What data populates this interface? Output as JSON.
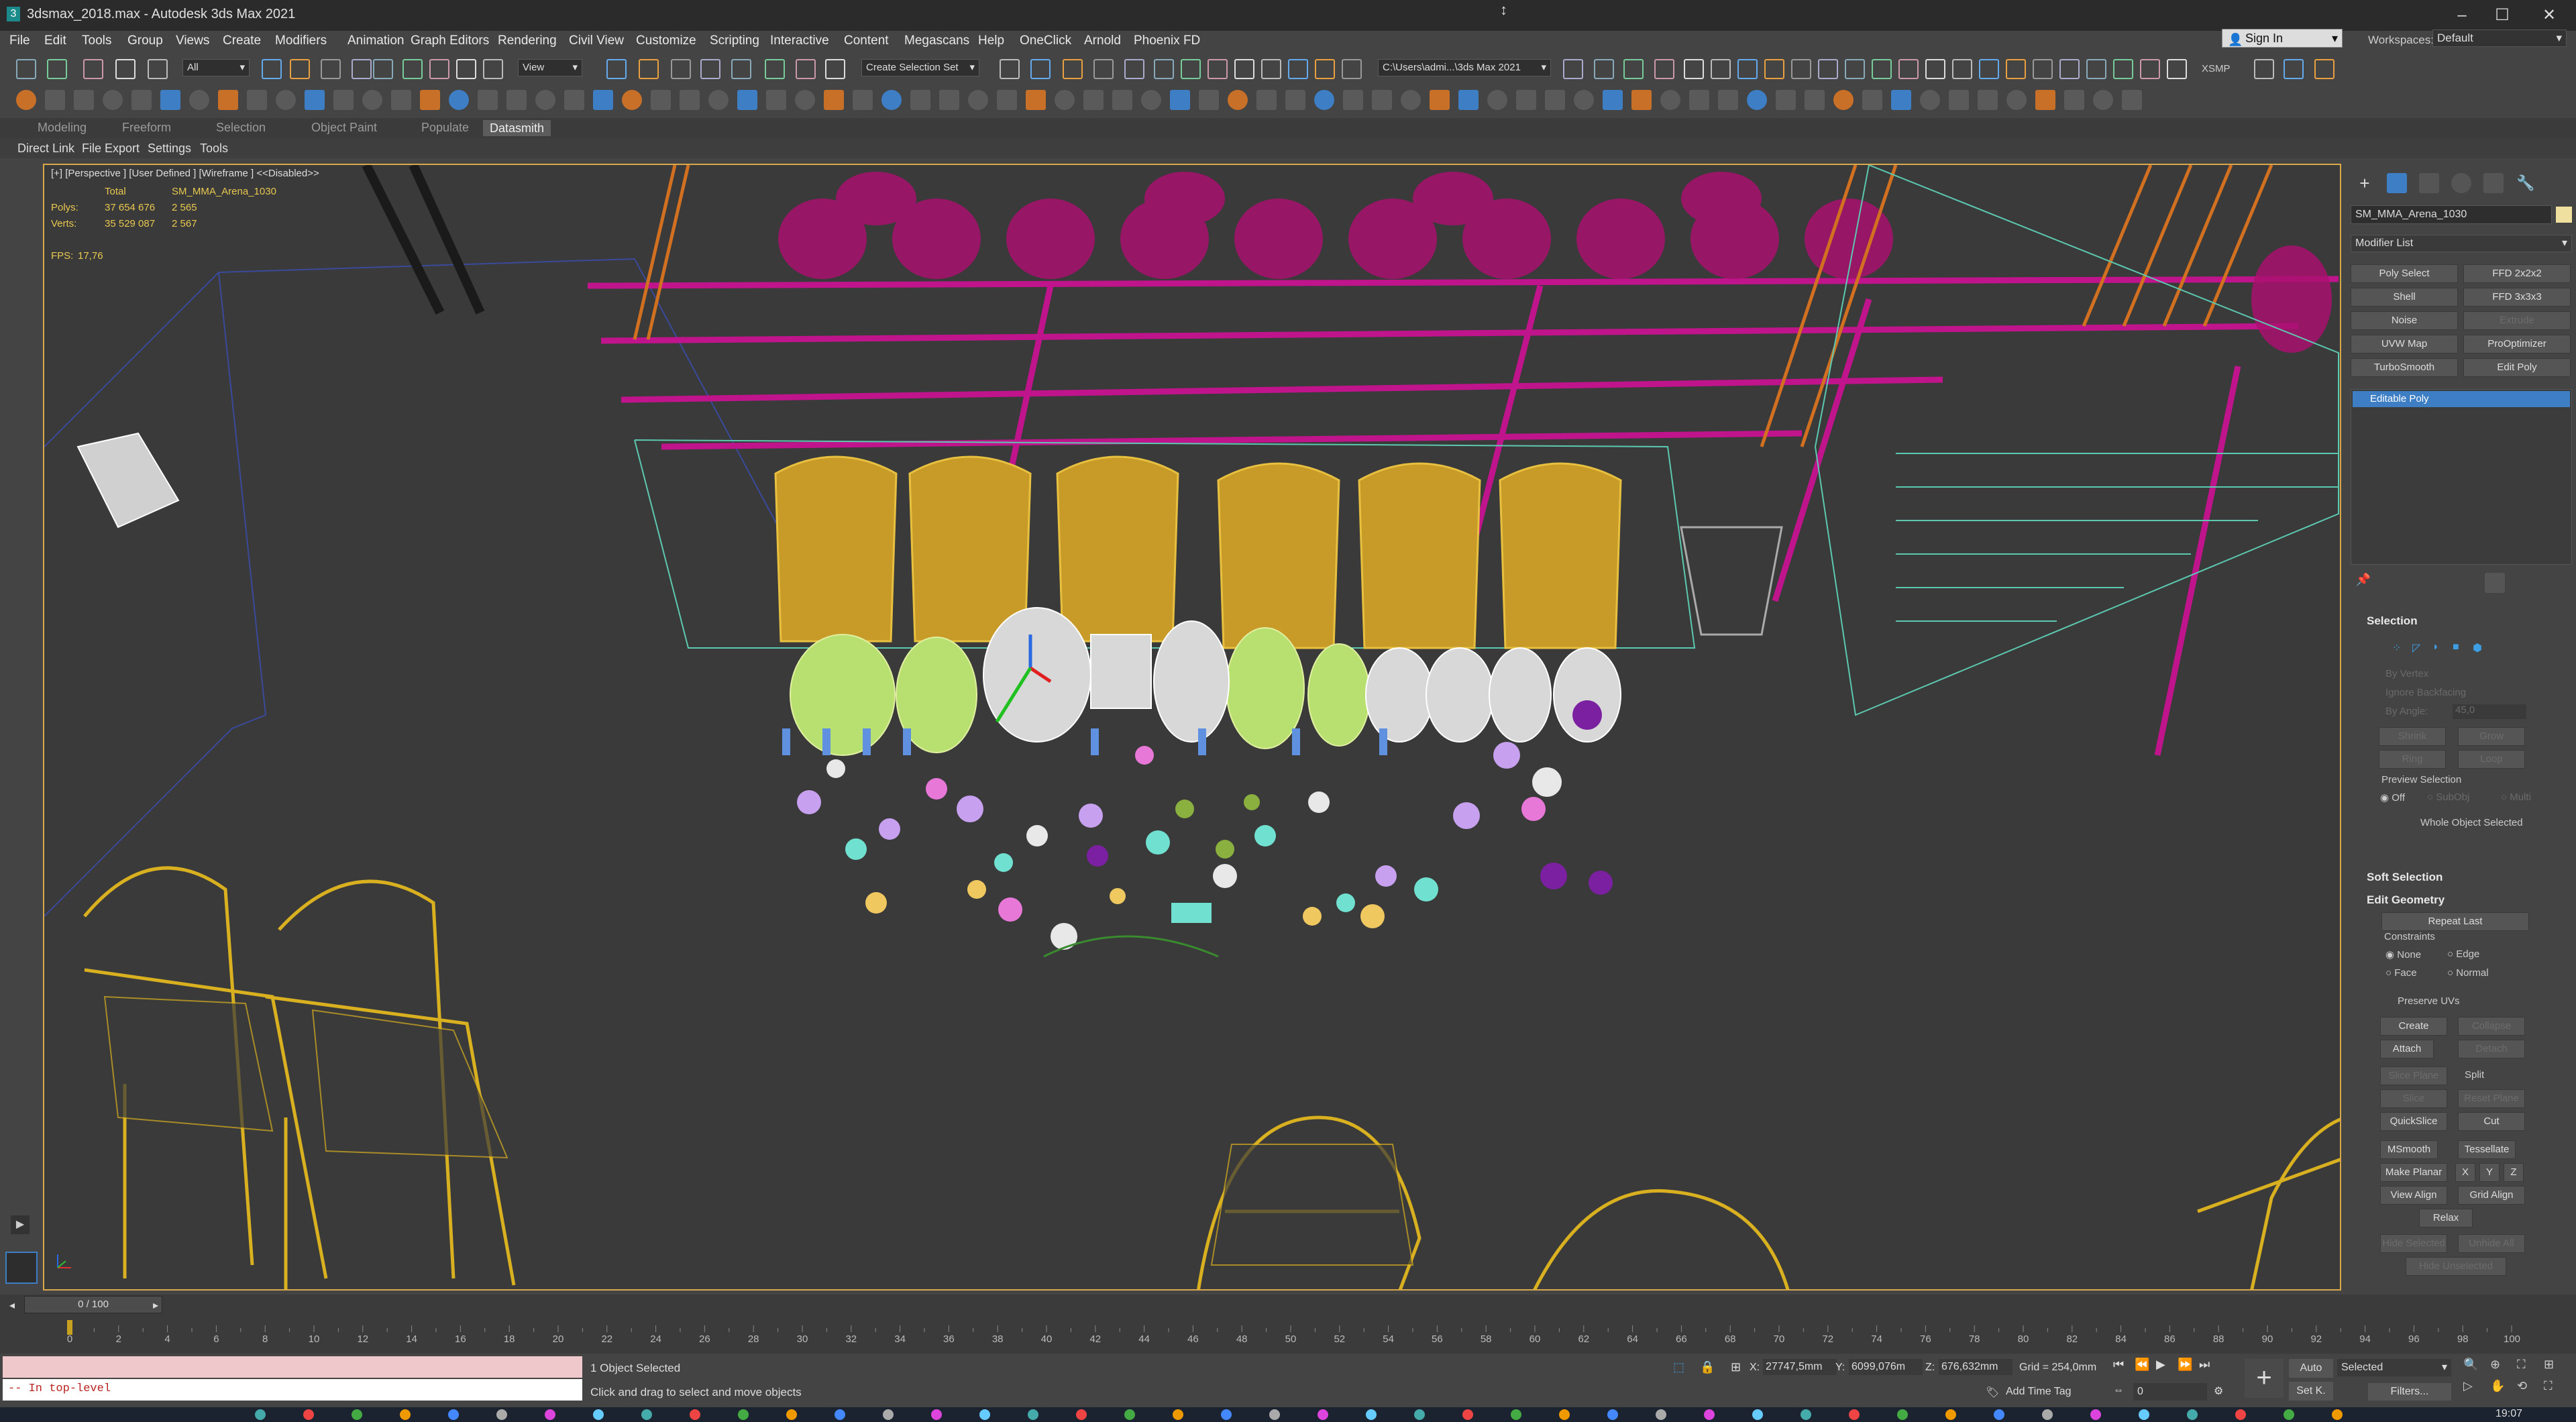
{
  "window": {
    "title": "3dsmax_2018.max - Autodesk 3ds Max 2021"
  },
  "menu": [
    "File",
    "Edit",
    "Tools",
    "Group",
    "Views",
    "Create",
    "Modifiers",
    "Animation",
    "Graph Editors",
    "Rendering",
    "Civil View",
    "Customize",
    "Scripting",
    "Interactive",
    "Content",
    "Megascans",
    "Help",
    "OneClick",
    "Arnold",
    "Phoenix FD"
  ],
  "signin": {
    "label": "Sign In"
  },
  "workspaces": {
    "label": "Workspaces:",
    "value": "Default"
  },
  "toolbar": {
    "filter_combo": "All",
    "view_combo": "View",
    "selection_set": "Create Selection Set",
    "project_path": "C:\\Users\\admi...\\3ds Max 2021",
    "xsmp": "XSMP"
  },
  "ribbon": {
    "tabs": [
      "Modeling",
      "Freeform",
      "Selection",
      "Object Paint",
      "Populate",
      "Datasmith"
    ],
    "active": "Datasmith",
    "subtabs": [
      "Direct Link",
      "File Export",
      "Settings",
      "Tools"
    ]
  },
  "viewport": {
    "label": "[+] [Perspective ] [User Defined ] [Wireframe ]  <<Disabled>>",
    "stats": {
      "total_label": "Total",
      "object_name": "SM_MMA_Arena_1030",
      "polys_label": "Polys:",
      "polys_total": "37 654 676",
      "polys_sel": "2 565",
      "verts_label": "Verts:",
      "verts_total": "35 529 087",
      "verts_sel": "2 567",
      "fps_label": "FPS:",
      "fps_value": "17,76"
    }
  },
  "command_panel": {
    "object_name": "SM_MMA_Arena_1030",
    "modifier_list": "Modifier List",
    "modifier_buttons": [
      "Poly Select",
      "FFD 2x2x2",
      "Shell",
      "FFD 3x3x3",
      "Noise",
      "Extrude",
      "UVW Map",
      "ProOptimizer",
      "TurboSmooth",
      "Edit Poly"
    ],
    "stack_item": "Editable Poly",
    "selection": {
      "title": "Selection",
      "by_vertex": "By Vertex",
      "ignore_backfacing": "Ignore Backfacing",
      "by_angle": "By Angle:",
      "angle_value": "45,0",
      "shrink": "Shrink",
      "grow": "Grow",
      "ring": "Ring",
      "loop": "Loop",
      "preview": "Preview Selection",
      "off": "Off",
      "subobj": "SubObj",
      "multi": "Multi",
      "whole": "Whole Object Selected"
    },
    "soft_selection": "Soft Selection",
    "edit_geometry": {
      "title": "Edit Geometry",
      "repeat_last": "Repeat Last",
      "constraints": "Constraints",
      "none": "None",
      "edge": "Edge",
      "face": "Face",
      "normal": "Normal",
      "preserve_uvs": "Preserve UVs",
      "create": "Create",
      "collapse": "Collapse",
      "attach": "Attach",
      "detach": "Detach",
      "slice_plane": "Slice Plane",
      "split": "Split",
      "slice": "Slice",
      "reset_plane": "Reset Plane",
      "quickslice": "QuickSlice",
      "cut": "Cut",
      "msmooth": "MSmooth",
      "tessellate": "Tessellate",
      "make_planar": "Make Planar",
      "x": "X",
      "y": "Y",
      "z": "Z",
      "view_align": "View Align",
      "grid_align": "Grid Align",
      "relax": "Relax",
      "hide_selected": "Hide Selected",
      "unhide_all": "Unhide All",
      "hide_unselected": "Hide Unselected"
    }
  },
  "timeline": {
    "frame_display": "0 / 100",
    "ticks": [
      "0",
      "2",
      "4",
      "6",
      "8",
      "10",
      "12",
      "14",
      "16",
      "18",
      "20",
      "22",
      "24",
      "26",
      "28",
      "30",
      "32",
      "34",
      "36",
      "38",
      "40",
      "42",
      "44",
      "46",
      "48",
      "50",
      "52",
      "54",
      "56",
      "58",
      "60",
      "62",
      "64",
      "66",
      "68",
      "70",
      "72",
      "74",
      "76",
      "78",
      "80",
      "82",
      "84",
      "86",
      "88",
      "90",
      "92",
      "94",
      "96",
      "98",
      "100"
    ]
  },
  "status": {
    "script_line": "-- In top-level",
    "selected": "1 Object Selected",
    "hint": "Click and drag to select and move objects",
    "x_label": "X:",
    "x": "27747,5mm",
    "y_label": "Y:",
    "y": "6099,076m",
    "z_label": "Z:",
    "z": "676,632mm",
    "grid": "Grid = 254,0mm",
    "add_time_tag": "Add Time Tag",
    "auto": "Auto",
    "set_k": "Set K.",
    "selected_combo": "Selected",
    "filters": "Filters...",
    "frame_field": "0",
    "clock": "19:07"
  },
  "colors": {
    "accent_blue": "#3d7ec4",
    "viewport_border": "#d8a84a",
    "wire_yellow": "#d8b020",
    "wire_magenta": "#c0148c",
    "wire_orange": "#d07020",
    "wire_cyan": "#60d0b0"
  }
}
